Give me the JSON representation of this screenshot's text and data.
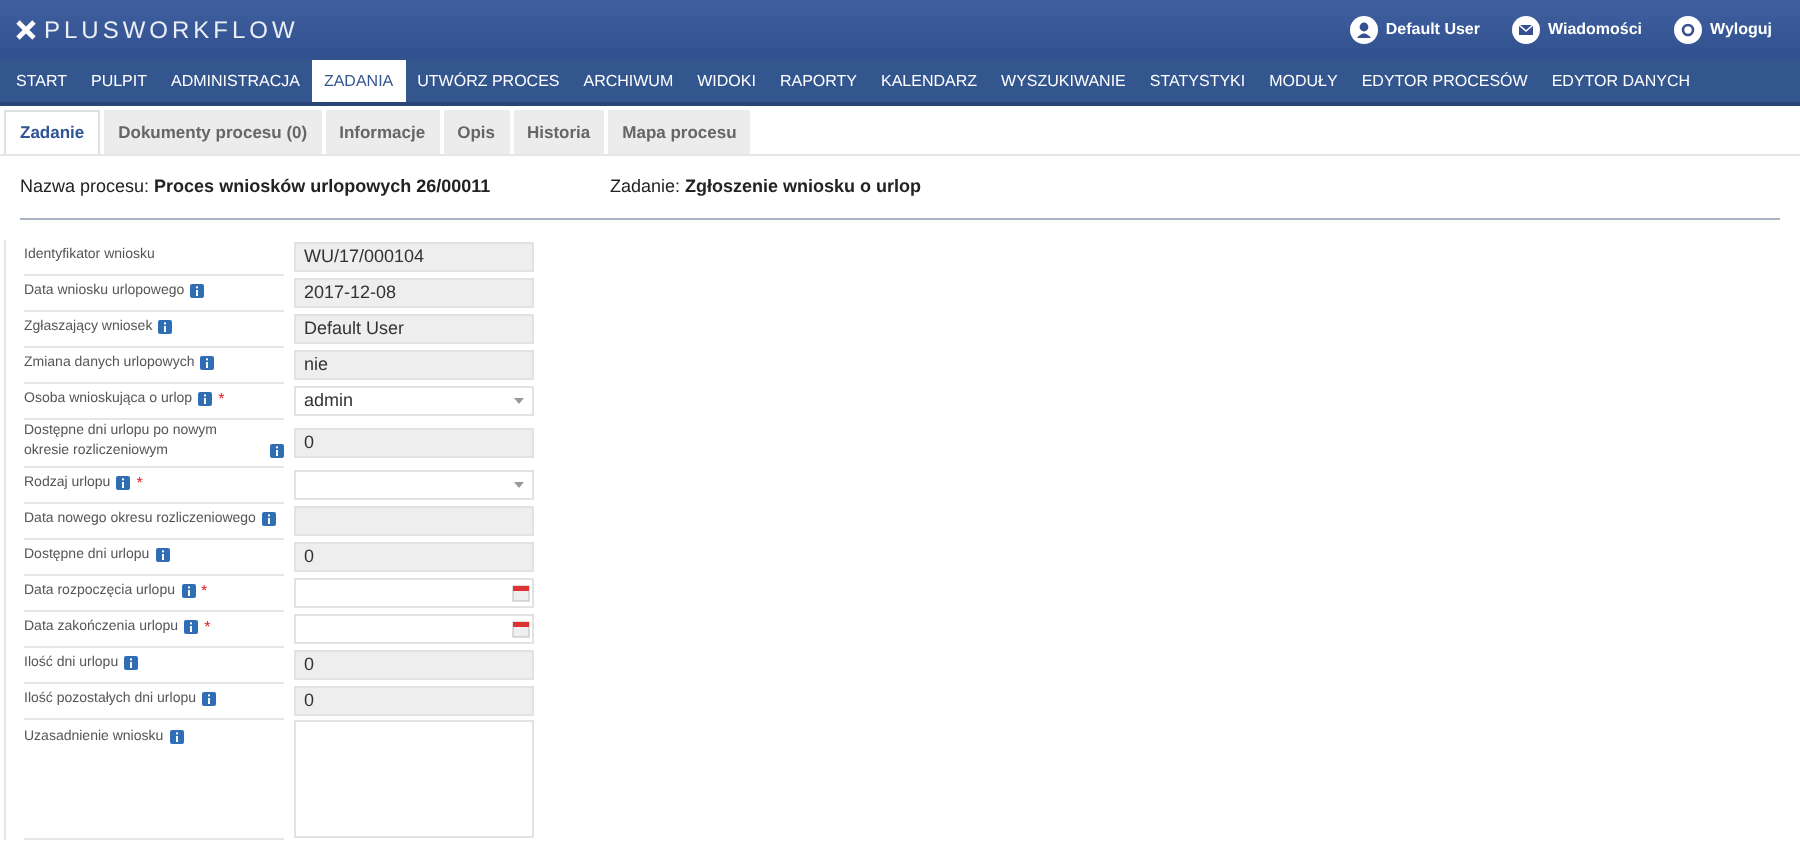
{
  "header": {
    "logo": "PLUSWORKFLOW",
    "links": [
      {
        "kind": "user",
        "label": "Default User"
      },
      {
        "kind": "mail",
        "label": "Wiadomości"
      },
      {
        "kind": "logout",
        "label": "Wyloguj"
      }
    ]
  },
  "nav": [
    {
      "label": "START",
      "selected": false
    },
    {
      "label": "PULPIT",
      "selected": false
    },
    {
      "label": "ADMINISTRACJA",
      "selected": false
    },
    {
      "label": "ZADANIA",
      "selected": true
    },
    {
      "label": "UTWÓRZ PROCES",
      "selected": false
    },
    {
      "label": "ARCHIWUM",
      "selected": false
    },
    {
      "label": "WIDOKI",
      "selected": false
    },
    {
      "label": "RAPORTY",
      "selected": false
    },
    {
      "label": "KALENDARZ",
      "selected": false
    },
    {
      "label": "WYSZUKIWANIE",
      "selected": false
    },
    {
      "label": "STATYSTYKI",
      "selected": false
    },
    {
      "label": "MODUŁY",
      "selected": false
    },
    {
      "label": "EDYTOR PROCESÓW",
      "selected": false
    },
    {
      "label": "EDYTOR DANYCH",
      "selected": false
    }
  ],
  "tabs": [
    {
      "label": "Zadanie",
      "selected": true
    },
    {
      "label": "Dokumenty procesu (0)",
      "selected": false
    },
    {
      "label": "Informacje",
      "selected": false
    },
    {
      "label": "Opis",
      "selected": false
    },
    {
      "label": "Historia",
      "selected": false
    },
    {
      "label": "Mapa procesu",
      "selected": false
    }
  ],
  "process": {
    "label": "Nazwa procesu:",
    "value": "Proces wniosków urlopowych 26/00011"
  },
  "task": {
    "label": "Zadanie:",
    "value": "Zgłoszenie wniosku o urlop"
  },
  "fields": [
    {
      "label": "Identyfikator wniosku",
      "info": false,
      "kind": "readonly",
      "value": "WU/17/000104"
    },
    {
      "label": "Data wniosku urlopowego",
      "info": true,
      "kind": "readonly",
      "value": "2017-12-08"
    },
    {
      "label": "Zgłaszający wniosek",
      "info": true,
      "kind": "readonly",
      "value": "Default User"
    },
    {
      "label": "Zmiana danych urlopowych",
      "info": true,
      "kind": "readonly",
      "value": "nie"
    },
    {
      "label": "Osoba wnioskująca o urlop",
      "info": true,
      "required_mark": "*",
      "kind": "select",
      "value": "admin"
    },
    {
      "label": "Dostępne dni urlopu po nowym okresie rozliczeniowym",
      "info": true,
      "kind": "readonly",
      "value": "0"
    },
    {
      "label": "Rodzaj urlopu",
      "info": true,
      "required_mark": "*",
      "kind": "select"
    },
    {
      "label": "Data nowego okresu rozliczeniowego",
      "info": true,
      "kind": "readonly"
    },
    {
      "label": "Dostępne dni urlopu",
      "info": true,
      "kind": "readonly",
      "value": "0"
    },
    {
      "label": "Data rozpoczęcia urlopu",
      "info": true,
      "required_mark": "*",
      "kind": "date"
    },
    {
      "label": "Data zakończenia urlopu",
      "info": true,
      "required_mark": "*",
      "kind": "date"
    },
    {
      "label": "Ilość dni urlopu",
      "info": true,
      "kind": "readonly",
      "value": "0"
    },
    {
      "label": "Ilość pozostałych dni urlopu",
      "info": true,
      "kind": "readonly",
      "value": "0"
    },
    {
      "label": "Uzasadnienie wniosku",
      "info": true,
      "kind": "textarea"
    }
  ]
}
